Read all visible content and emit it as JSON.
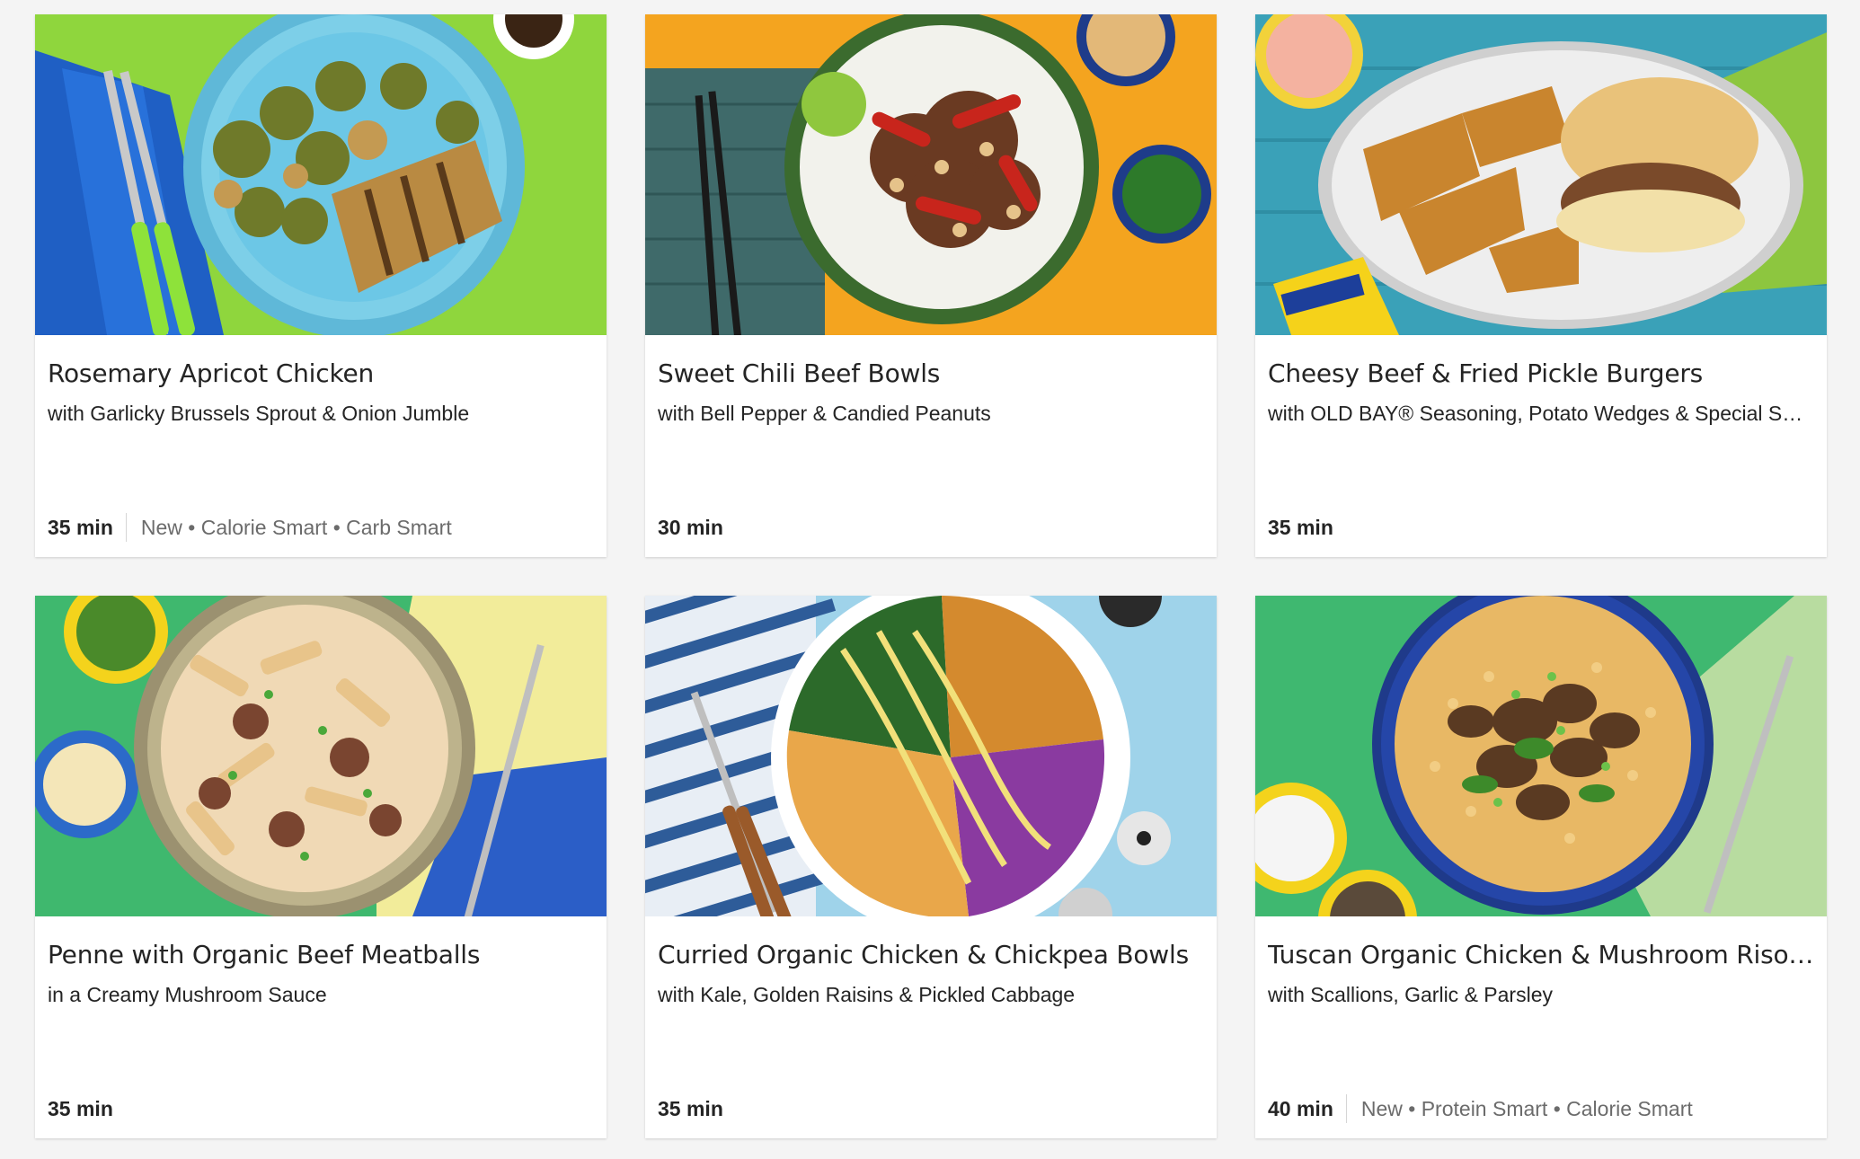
{
  "recipes": [
    {
      "title": "Rosemary Apricot Chicken",
      "subtitle": "with Garlicky Brussels Sprout & Onion Jumble",
      "time": "35 min",
      "tags": "New • Calorie Smart • Carb Smart",
      "photo": "roast-chicken-brussels-sprouts-photo",
      "colors": {
        "bg": "#8fd63d",
        "plate": "#6cc7e6",
        "food": "#7a5a2a"
      }
    },
    {
      "title": "Sweet Chili Beef Bowls",
      "subtitle": "with Bell Pepper & Candied Peanuts",
      "time": "30 min",
      "tags": "",
      "photo": "beef-rice-bowl-photo",
      "colors": {
        "bg": "#f4a41f",
        "plate": "#4a7a3a",
        "food": "#b8321e"
      }
    },
    {
      "title": "Cheesy Beef & Fried Pickle Burgers",
      "subtitle": "with OLD BAY® Seasoning, Potato Wedges & Special Sauce",
      "time": "35 min",
      "tags": "",
      "photo": "burger-potato-wedges-photo",
      "colors": {
        "bg": "#3aa1b8",
        "plate": "#e8e8e8",
        "food": "#c9852e"
      }
    },
    {
      "title": "Penne with Organic Beef Meatballs",
      "subtitle": "in a Creamy Mushroom Sauce",
      "time": "35 min",
      "tags": "",
      "photo": "penne-meatballs-photo",
      "colors": {
        "bg": "#3fb86e",
        "plate": "#a89f7c",
        "food": "#f0d9b5"
      }
    },
    {
      "title": "Curried Organic Chicken & Chickpea Bowls",
      "subtitle": "with Kale, Golden Raisins & Pickled Cabbage",
      "time": "35 min",
      "tags": "",
      "photo": "chickpea-kale-bowl-photo",
      "colors": {
        "bg": "#9fd3ea",
        "plate": "#ffffff",
        "food": "#8a3aa0"
      }
    },
    {
      "title": "Tuscan Organic Chicken & Mushroom Risotto",
      "subtitle": "with Scallions, Garlic & Parsley",
      "time": "40 min",
      "tags": "New • Protein Smart • Calorie Smart",
      "photo": "mushroom-risotto-photo",
      "colors": {
        "bg": "#3fb870",
        "plate": "#2546a8",
        "food": "#e8b865"
      }
    }
  ]
}
